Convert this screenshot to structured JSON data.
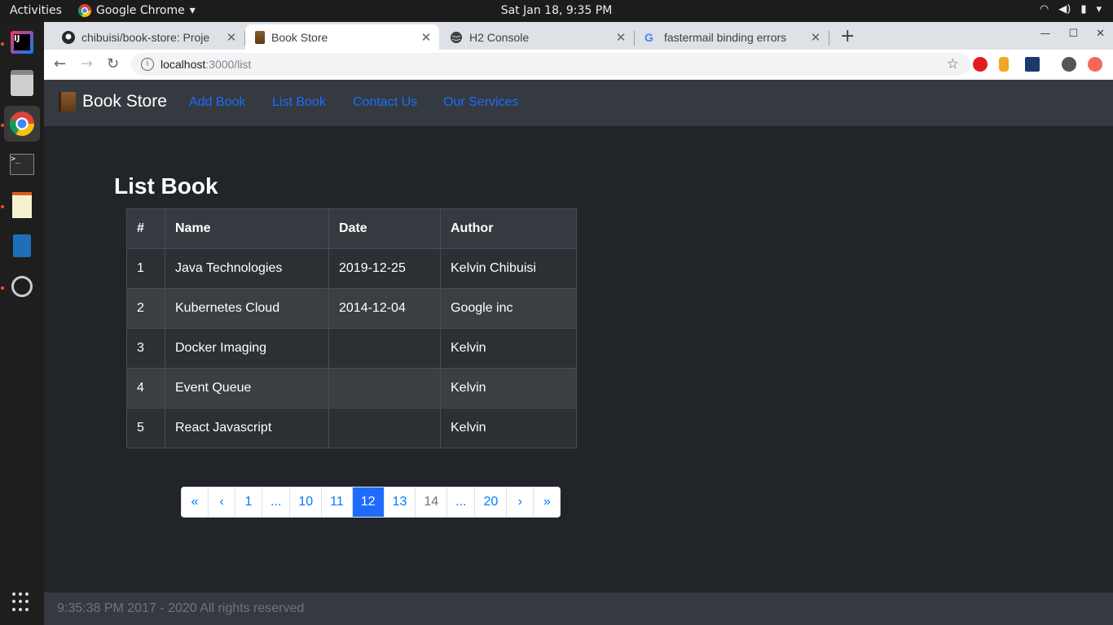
{
  "os": {
    "activities": "Activities",
    "app_name": "Google Chrome",
    "clock": "Sat Jan 18,  9:35 PM"
  },
  "browser": {
    "tabs": [
      {
        "title": "chibuisi/book-store: Proje",
        "icon": "github-icon"
      },
      {
        "title": "Book Store",
        "icon": "book-icon"
      },
      {
        "title": "H2 Console",
        "icon": "globe-icon"
      },
      {
        "title": "fastermail binding errors",
        "icon": "google-icon"
      }
    ],
    "url_host": "localhost",
    "url_path": ":3000/list"
  },
  "navbar": {
    "brand": "Book Store",
    "links": [
      "Add Book",
      "List Book",
      "Contact Us",
      "Our Services"
    ]
  },
  "main": {
    "title": "List Book",
    "table": {
      "headers": [
        "#",
        "Name",
        "Date",
        "Author"
      ],
      "rows": [
        [
          "1",
          "Java Technologies",
          "2019-12-25",
          "Kelvin Chibuisi"
        ],
        [
          "2",
          "Kubernetes Cloud",
          "2014-12-04",
          "Google inc"
        ],
        [
          "3",
          "Docker Imaging",
          "",
          "Kelvin"
        ],
        [
          "4",
          "Event Queue",
          "",
          "Kelvin"
        ],
        [
          "5",
          "React Javascript",
          "",
          "Kelvin"
        ]
      ]
    },
    "pagination": [
      "«",
      "‹",
      "1",
      "...",
      "10",
      "11",
      "12",
      "13",
      "14",
      "...",
      "20",
      "›",
      "»"
    ],
    "current_page": "12"
  },
  "footer": {
    "text": "9:35:38 PM 2017 - 2020 All rights reserved"
  },
  "colors": {
    "page_bg": "#212529",
    "navbar_bg": "#343a40",
    "link": "#1f6bff",
    "active_page": "#1f6bff"
  }
}
